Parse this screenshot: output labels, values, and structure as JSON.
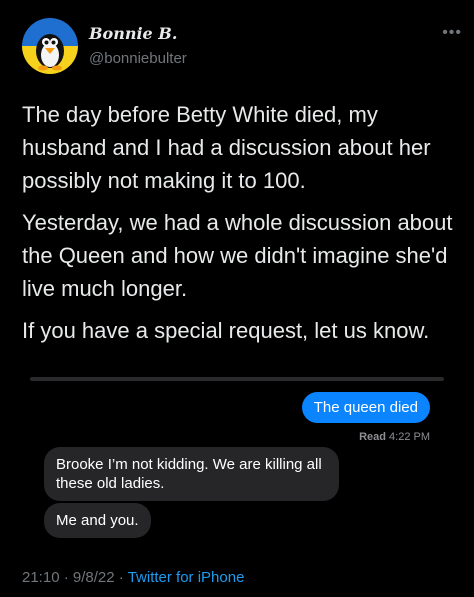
{
  "author": {
    "name": "Bonnie B.",
    "handle": "@bonniebulter",
    "avatar_icon": "penguin-icon",
    "avatar_colors": [
      "#1f6fd0",
      "#f6d21c"
    ]
  },
  "more_icon": "more-options-icon",
  "tweet": {
    "paragraphs": [
      "The day before Betty White died, my husband and I had a discussion about her possibly not making it to 100.",
      "Yesterday, we had a whole discussion about the Queen and how we didn't imagine she'd live much longer.",
      "If you have a special request, let us know."
    ]
  },
  "screenshot": {
    "sent": "The queen died",
    "read_label": "Read",
    "read_time": "4:22 PM",
    "received": [
      "Brooke I’m not kidding. We are killing all these old ladies.",
      "Me and you."
    ],
    "colors": {
      "sent": "#0a84ff",
      "received": "#262628"
    }
  },
  "footer": {
    "time": "21:10",
    "date": "9/8/22",
    "separator": "·",
    "source": "Twitter for iPhone"
  },
  "colors": {
    "background": "#000000",
    "text": "#e7e9ea",
    "muted": "#71767b",
    "link": "#1d9bf0"
  }
}
